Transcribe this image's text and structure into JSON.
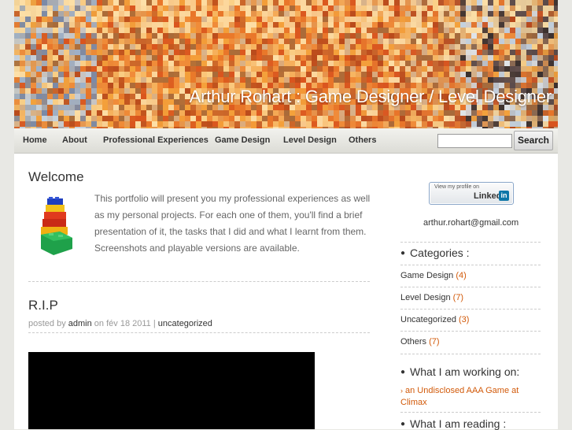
{
  "header": {
    "site_title": "Arthur Rohart : Game Designer / Level Designer"
  },
  "nav": {
    "items": [
      {
        "label": "Home"
      },
      {
        "label": "About"
      },
      {
        "label": "Professional Experiences"
      },
      {
        "label": "Game Design"
      },
      {
        "label": "Level Design"
      },
      {
        "label": "Others"
      }
    ],
    "search_value": "",
    "search_button": "Search"
  },
  "welcome": {
    "title": "Welcome",
    "text": "This portfolio will present you my professional experiences as well as my personal projects. For each one of them, you'll find a brief presentation of it, the tasks that I did and what I learnt from them. Screenshots and playable versions are available."
  },
  "post": {
    "title": "R.I.P",
    "posted_by": "posted by",
    "author": "admin",
    "on": "on",
    "date": "fév 18 2011",
    "sep": "|",
    "category": "uncategorized"
  },
  "sidebar": {
    "linkedin_small": "View my profile on",
    "linkedin_brand": "Linked",
    "linkedin_in": "in",
    "email": "arthur.rohart@gmail.com",
    "categories_title": "Categories :",
    "categories": [
      {
        "name": "Game Design",
        "count": "(4)"
      },
      {
        "name": "Level Design",
        "count": "(7)"
      },
      {
        "name": "Uncategorized",
        "count": "(3)"
      },
      {
        "name": "Others",
        "count": "(7)"
      }
    ],
    "working_title": "What I am working on:",
    "working_item": "an Undisclosed AAA Game at Climax",
    "reading_title": "What I am reading :"
  },
  "colors": {
    "accent_orange": "#d25a0a",
    "nav_bg": "#e4e4de",
    "page_bg": "#e8e8e4"
  },
  "icons": {
    "bullet": "bullet-icon",
    "arrow": "arrow-right-icon",
    "lego": "lego-stack-icon"
  }
}
